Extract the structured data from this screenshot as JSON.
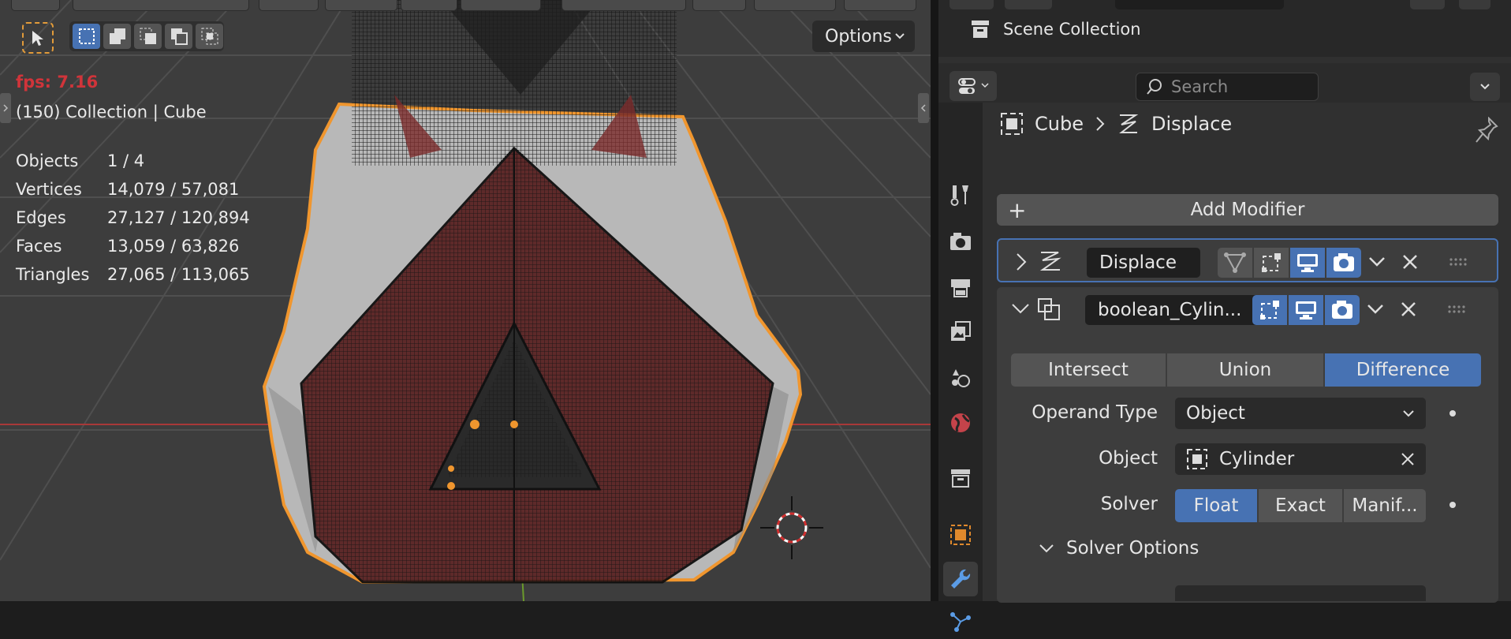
{
  "viewport": {
    "options_label": "Options",
    "fps": "fps: 7.16",
    "context": "(150) Collection | Cube",
    "stats": [
      {
        "label": "Objects",
        "value": "1 / 4"
      },
      {
        "label": "Vertices",
        "value": "14,079 / 57,081"
      },
      {
        "label": "Edges",
        "value": "27,127 / 120,894"
      },
      {
        "label": "Faces",
        "value": "13,059 / 63,826"
      },
      {
        "label": "Triangles",
        "value": "27,065 / 113,065"
      }
    ]
  },
  "outliner": {
    "scene_collection": "Scene Collection"
  },
  "properties": {
    "search_placeholder": "Search",
    "breadcrumb": {
      "object": "Cube",
      "modifier": "Displace"
    },
    "add_modifier": "Add Modifier",
    "modifiers": [
      {
        "name": "Displace",
        "expanded": false
      },
      {
        "name": "boolean_Cylin...",
        "expanded": true
      }
    ],
    "operation": {
      "options": [
        "Intersect",
        "Union",
        "Difference"
      ],
      "selected": "Difference"
    },
    "operand_type": {
      "label": "Operand Type",
      "value": "Object"
    },
    "object": {
      "label": "Object",
      "value": "Cylinder"
    },
    "solver": {
      "label": "Solver",
      "options": [
        "Float",
        "Exact",
        "Manif..."
      ],
      "selected": "Float"
    },
    "solver_options": "Solver Options"
  },
  "colors": {
    "accent": "#4772b3",
    "selection_outline": "#f0962e",
    "fps_text": "#d0343a",
    "viewport_bg": "#3d3d3d",
    "panel_bg": "#303030"
  }
}
